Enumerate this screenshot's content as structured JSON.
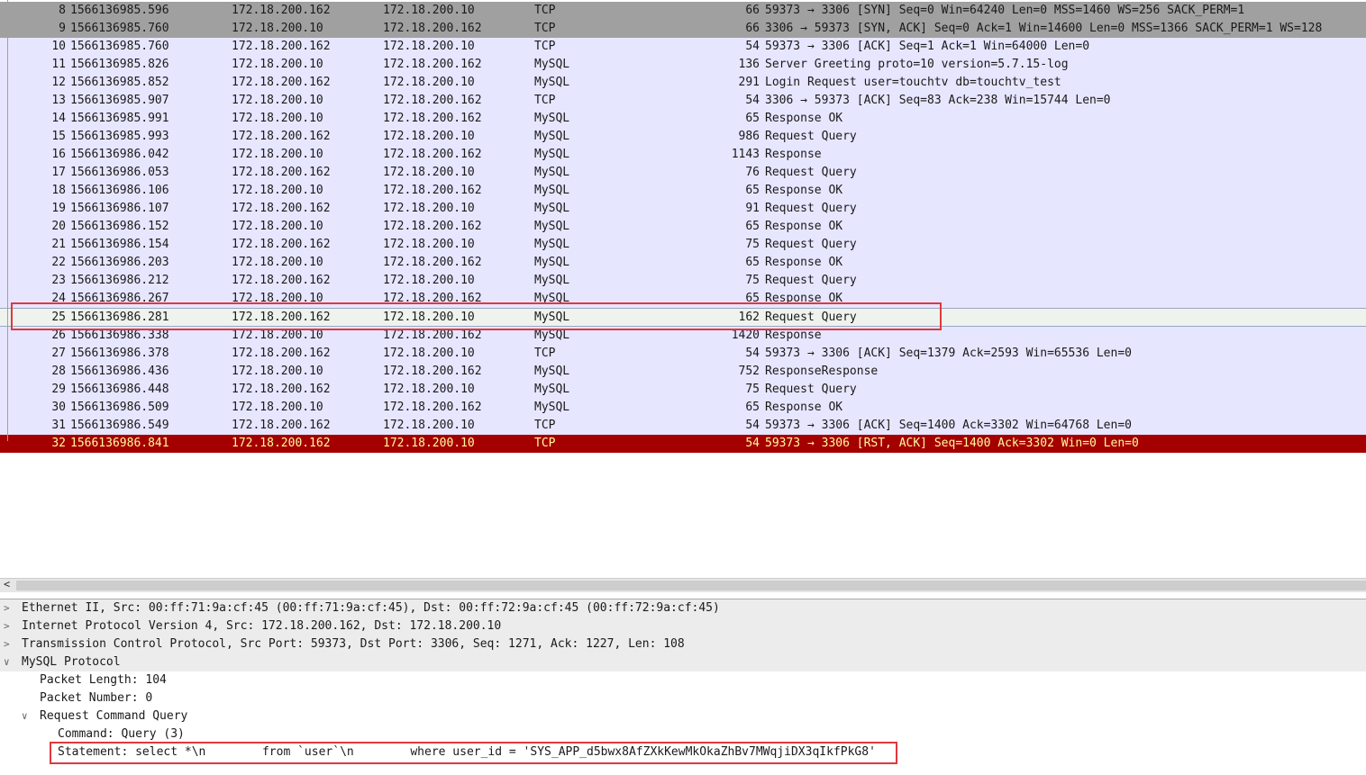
{
  "packets": [
    {
      "no": "8",
      "time": "1566136985.596",
      "src": "172.18.200.162",
      "dst": "172.18.200.10",
      "proto": "TCP",
      "len": "66",
      "info": "59373 → 3306 [SYN] Seq=0 Win=64240 Len=0 MSS=1460 WS=256 SACK_PERM=1",
      "style": "dark"
    },
    {
      "no": "9",
      "time": "1566136985.760",
      "src": "172.18.200.10",
      "dst": "172.18.200.162",
      "proto": "TCP",
      "len": "66",
      "info": "3306 → 59373 [SYN, ACK] Seq=0 Ack=1 Win=14600 Len=0 MSS=1366 SACK_PERM=1 WS=128",
      "style": "dark"
    },
    {
      "no": "10",
      "time": "1566136985.760",
      "src": "172.18.200.162",
      "dst": "172.18.200.10",
      "proto": "TCP",
      "len": "54",
      "info": "59373 → 3306 [ACK] Seq=1 Ack=1 Win=64000 Len=0",
      "style": ""
    },
    {
      "no": "11",
      "time": "1566136985.826",
      "src": "172.18.200.10",
      "dst": "172.18.200.162",
      "proto": "MySQL",
      "len": "136",
      "info": "Server Greeting proto=10 version=5.7.15-log",
      "style": ""
    },
    {
      "no": "12",
      "time": "1566136985.852",
      "src": "172.18.200.162",
      "dst": "172.18.200.10",
      "proto": "MySQL",
      "len": "291",
      "info": "Login Request user=touchtv db=touchtv_test",
      "style": ""
    },
    {
      "no": "13",
      "time": "1566136985.907",
      "src": "172.18.200.10",
      "dst": "172.18.200.162",
      "proto": "TCP",
      "len": "54",
      "info": "3306 → 59373 [ACK] Seq=83 Ack=238 Win=15744 Len=0",
      "style": ""
    },
    {
      "no": "14",
      "time": "1566136985.991",
      "src": "172.18.200.10",
      "dst": "172.18.200.162",
      "proto": "MySQL",
      "len": "65",
      "info": "Response OK",
      "style": ""
    },
    {
      "no": "15",
      "time": "1566136985.993",
      "src": "172.18.200.162",
      "dst": "172.18.200.10",
      "proto": "MySQL",
      "len": "986",
      "info": "Request Query",
      "style": ""
    },
    {
      "no": "16",
      "time": "1566136986.042",
      "src": "172.18.200.10",
      "dst": "172.18.200.162",
      "proto": "MySQL",
      "len": "1143",
      "info": "Response",
      "style": ""
    },
    {
      "no": "17",
      "time": "1566136986.053",
      "src": "172.18.200.162",
      "dst": "172.18.200.10",
      "proto": "MySQL",
      "len": "76",
      "info": "Request Query",
      "style": ""
    },
    {
      "no": "18",
      "time": "1566136986.106",
      "src": "172.18.200.10",
      "dst": "172.18.200.162",
      "proto": "MySQL",
      "len": "65",
      "info": "Response OK",
      "style": ""
    },
    {
      "no": "19",
      "time": "1566136986.107",
      "src": "172.18.200.162",
      "dst": "172.18.200.10",
      "proto": "MySQL",
      "len": "91",
      "info": "Request Query",
      "style": ""
    },
    {
      "no": "20",
      "time": "1566136986.152",
      "src": "172.18.200.10",
      "dst": "172.18.200.162",
      "proto": "MySQL",
      "len": "65",
      "info": "Response OK",
      "style": ""
    },
    {
      "no": "21",
      "time": "1566136986.154",
      "src": "172.18.200.162",
      "dst": "172.18.200.10",
      "proto": "MySQL",
      "len": "75",
      "info": "Request Query",
      "style": ""
    },
    {
      "no": "22",
      "time": "1566136986.203",
      "src": "172.18.200.10",
      "dst": "172.18.200.162",
      "proto": "MySQL",
      "len": "65",
      "info": "Response OK",
      "style": ""
    },
    {
      "no": "23",
      "time": "1566136986.212",
      "src": "172.18.200.162",
      "dst": "172.18.200.10",
      "proto": "MySQL",
      "len": "75",
      "info": "Request Query",
      "style": ""
    },
    {
      "no": "24",
      "time": "1566136986.267",
      "src": "172.18.200.10",
      "dst": "172.18.200.162",
      "proto": "MySQL",
      "len": "65",
      "info": "Response OK",
      "style": ""
    },
    {
      "no": "25",
      "time": "1566136986.281",
      "src": "172.18.200.162",
      "dst": "172.18.200.10",
      "proto": "MySQL",
      "len": "162",
      "info": "Request Query",
      "style": "sel"
    },
    {
      "no": "26",
      "time": "1566136986.338",
      "src": "172.18.200.10",
      "dst": "172.18.200.162",
      "proto": "MySQL",
      "len": "1420",
      "info": "Response",
      "style": ""
    },
    {
      "no": "27",
      "time": "1566136986.378",
      "src": "172.18.200.162",
      "dst": "172.18.200.10",
      "proto": "TCP",
      "len": "54",
      "info": "59373 → 3306 [ACK] Seq=1379 Ack=2593 Win=65536 Len=0",
      "style": ""
    },
    {
      "no": "28",
      "time": "1566136986.436",
      "src": "172.18.200.10",
      "dst": "172.18.200.162",
      "proto": "MySQL",
      "len": "752",
      "info": "ResponseResponse",
      "style": ""
    },
    {
      "no": "29",
      "time": "1566136986.448",
      "src": "172.18.200.162",
      "dst": "172.18.200.10",
      "proto": "MySQL",
      "len": "75",
      "info": "Request Query",
      "style": ""
    },
    {
      "no": "30",
      "time": "1566136986.509",
      "src": "172.18.200.10",
      "dst": "172.18.200.162",
      "proto": "MySQL",
      "len": "65",
      "info": "Response OK",
      "style": ""
    },
    {
      "no": "31",
      "time": "1566136986.549",
      "src": "172.18.200.162",
      "dst": "172.18.200.10",
      "proto": "TCP",
      "len": "54",
      "info": "59373 → 3306 [ACK] Seq=1400 Ack=3302 Win=64768 Len=0",
      "style": ""
    },
    {
      "no": "32",
      "time": "1566136986.841",
      "src": "172.18.200.162",
      "dst": "172.18.200.10",
      "proto": "TCP",
      "len": "54",
      "info": "59373 → 3306 [RST, ACK] Seq=1400 Ack=3302 Win=0 Len=0",
      "style": "err"
    }
  ],
  "details": [
    {
      "text": "Ethernet II, Src: 00:ff:71:9a:cf:45 (00:ff:71:9a:cf:45), Dst: 00:ff:72:9a:cf:45 (00:ff:72:9a:cf:45)",
      "level": 0,
      "toggle": "collapsed"
    },
    {
      "text": "Internet Protocol Version 4, Src: 172.18.200.162, Dst: 172.18.200.10",
      "level": 0,
      "toggle": "collapsed"
    },
    {
      "text": "Transmission Control Protocol, Src Port: 59373, Dst Port: 3306, Seq: 1271, Ack: 1227, Len: 108",
      "level": 0,
      "toggle": "collapsed"
    },
    {
      "text": "MySQL Protocol",
      "level": 0,
      "toggle": "expanded"
    },
    {
      "text": "Packet Length: 104",
      "level": 1,
      "toggle": ""
    },
    {
      "text": "Packet Number: 0",
      "level": 1,
      "toggle": ""
    },
    {
      "text": "Request Command Query",
      "level": 1,
      "toggle": "expanded"
    },
    {
      "text": "Command: Query (3)",
      "level": 2,
      "toggle": ""
    },
    {
      "text": "Statement: select *\\n        from `user`\\n        where user_id = 'SYS_APP_d5bwx8AfZXkKewMkOkaZhBv7MWqjiDX3qIkfPkG8'",
      "level": 2,
      "toggle": ""
    }
  ],
  "colors": {
    "highlight_box": "#e0383e",
    "error_row_bg": "#a40000",
    "error_row_text": "#fffc9c",
    "row_bg": "#e7e6ff"
  }
}
